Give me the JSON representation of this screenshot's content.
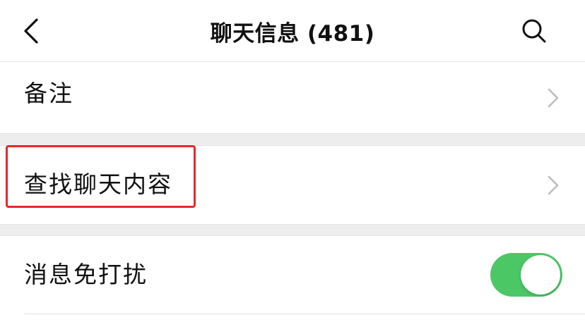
{
  "header": {
    "title": "聊天信息 (481)",
    "back_icon": "chevron-left-icon",
    "search_icon": "search-icon"
  },
  "rows": {
    "remark": {
      "label": "备注",
      "icon": "chevron-right-icon"
    },
    "search_chat": {
      "label": "查找聊天内容",
      "icon": "chevron-right-icon",
      "highlighted": true
    },
    "mute": {
      "label": "消息免打扰",
      "toggle_on": true
    }
  },
  "colors": {
    "toggle_on": "#4cc766",
    "highlight_border": "#e8262a",
    "section_gap": "#ededed",
    "chevron": "#bdbdbd"
  }
}
